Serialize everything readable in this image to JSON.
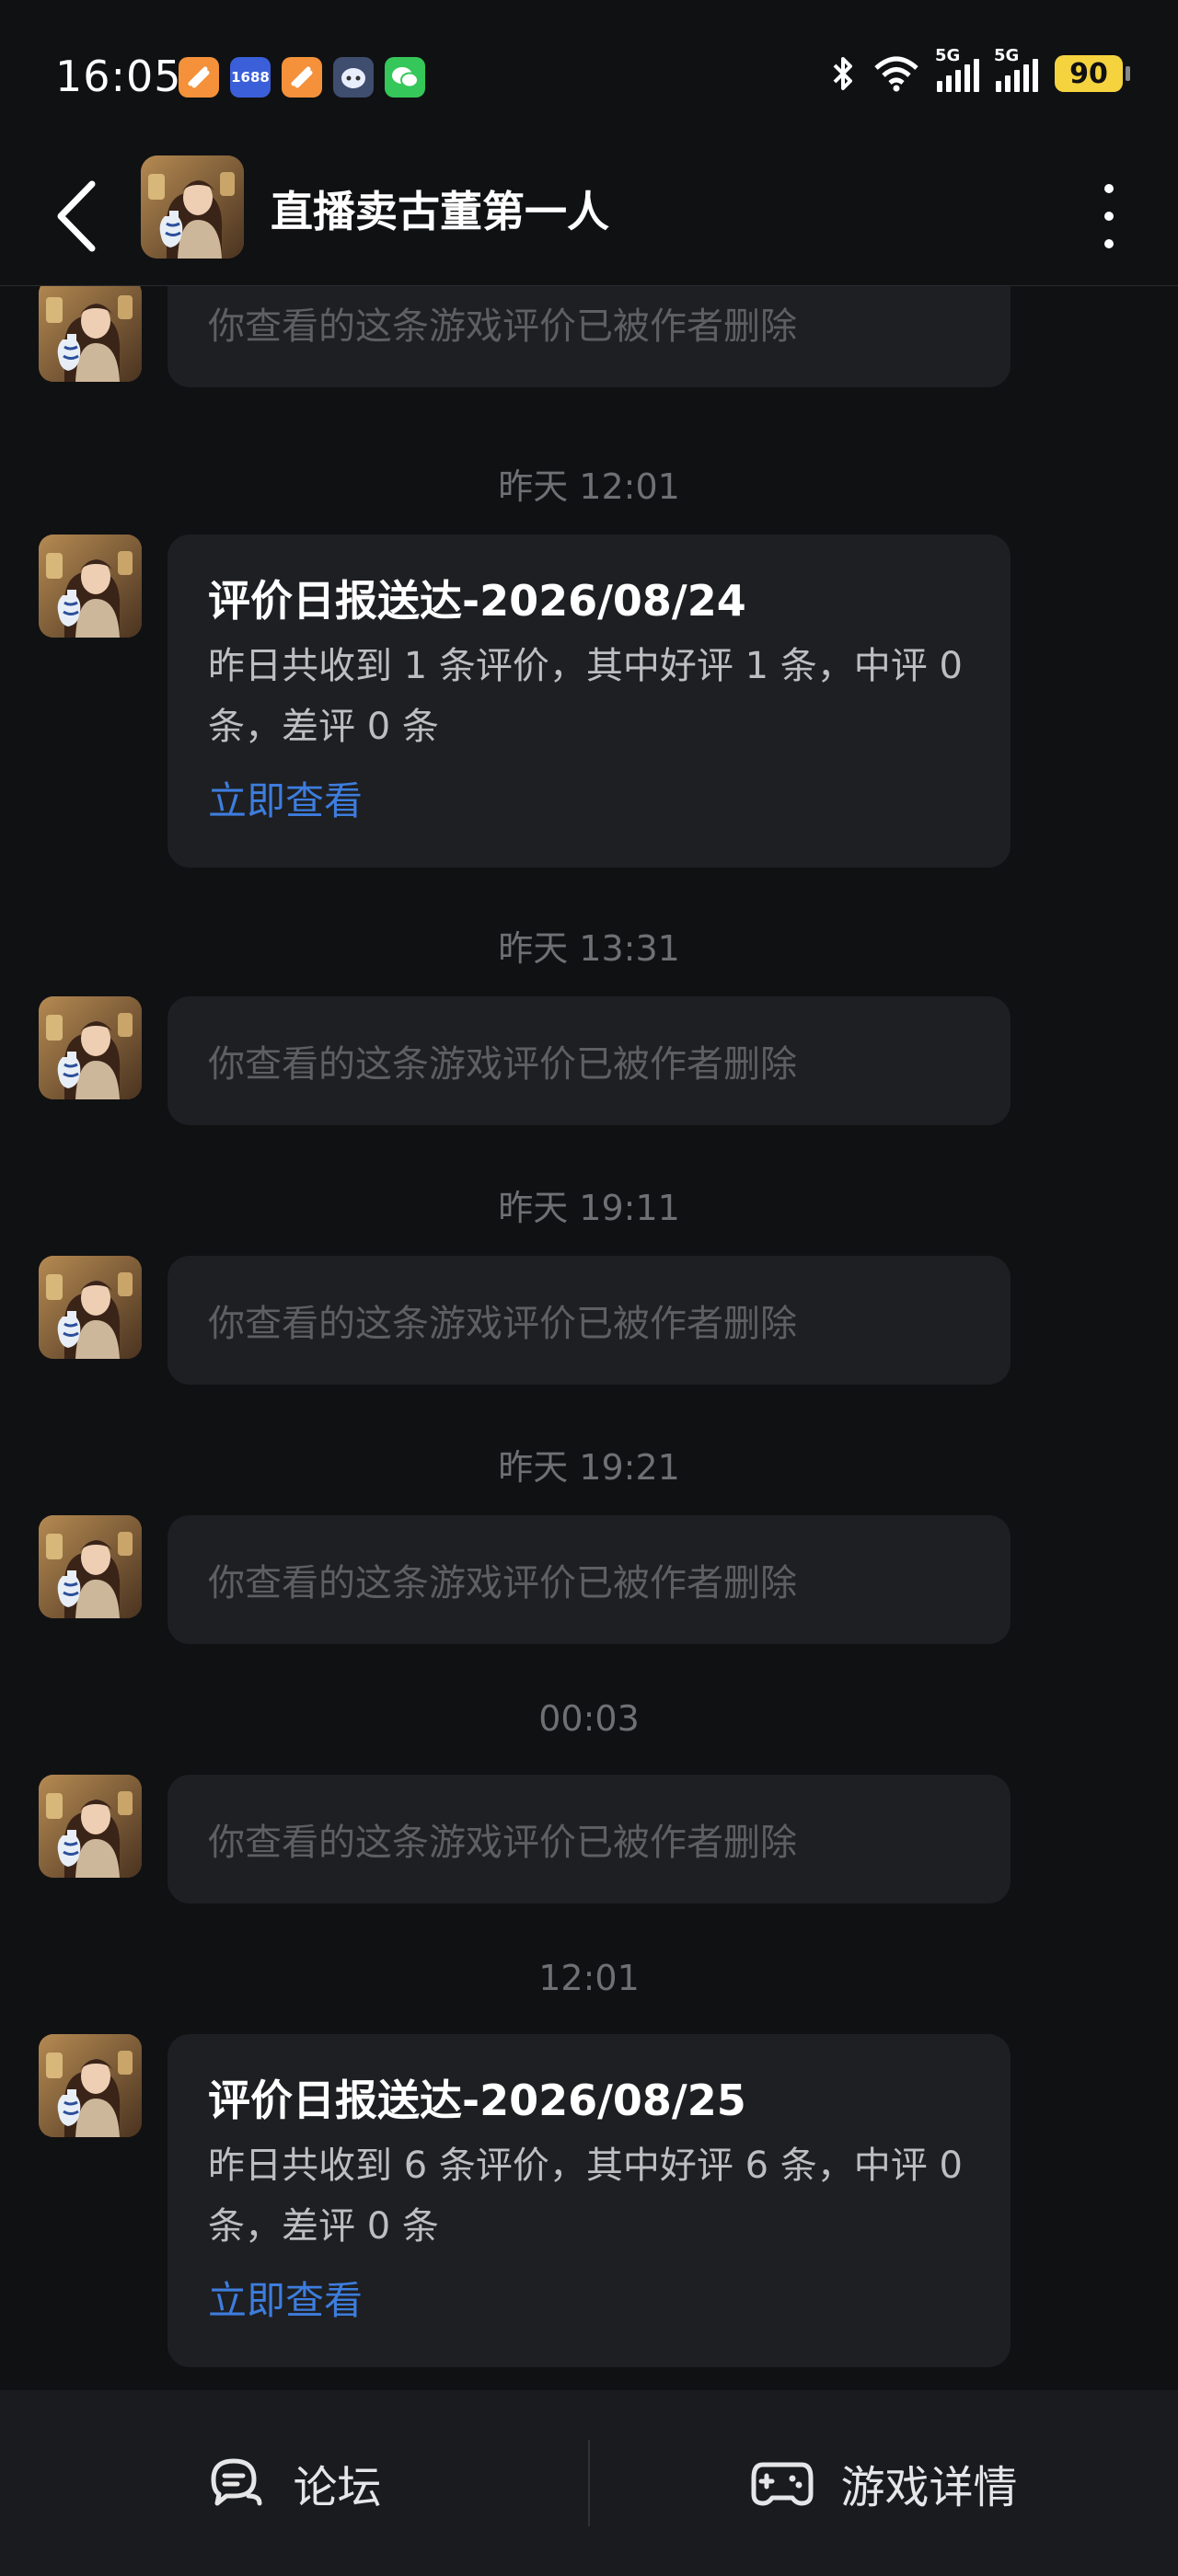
{
  "status_bar": {
    "time": "16:05",
    "apps": [
      "taobao-icon",
      "1688-icon",
      "taobao-icon",
      "ai-assistant-icon",
      "wechat-icon"
    ],
    "app_1688_label": "1688",
    "network": "5G",
    "battery": "90"
  },
  "header": {
    "title": "直播卖古董第一人"
  },
  "messages": [
    {
      "type": "deleted",
      "text": "你查看的这条游戏评价已被作者删除"
    },
    {
      "type": "timestamp",
      "text": "昨天 12:01"
    },
    {
      "type": "report",
      "title": "评价日报送达-2026/08/24",
      "body": "昨日共收到 1 条评价，其中好评 1 条，中评 0 条，差评 0 条",
      "link": "立即查看"
    },
    {
      "type": "timestamp",
      "text": "昨天 13:31"
    },
    {
      "type": "deleted",
      "text": "你查看的这条游戏评价已被作者删除"
    },
    {
      "type": "timestamp",
      "text": "昨天 19:11"
    },
    {
      "type": "deleted",
      "text": "你查看的这条游戏评价已被作者删除"
    },
    {
      "type": "timestamp",
      "text": "昨天 19:21"
    },
    {
      "type": "deleted",
      "text": "你查看的这条游戏评价已被作者删除"
    },
    {
      "type": "timestamp",
      "text": "00:03"
    },
    {
      "type": "deleted",
      "text": "你查看的这条游戏评价已被作者删除"
    },
    {
      "type": "timestamp",
      "text": "12:01"
    },
    {
      "type": "report",
      "title": "评价日报送达-2026/08/25",
      "body": "昨日共收到 6 条评价，其中好评 6 条，中评 0 条，差评 0 条",
      "link": "立即查看"
    }
  ],
  "bottom_bar": {
    "forum_label": "论坛",
    "game_detail_label": "游戏详情"
  },
  "colors": {
    "background": "#101113",
    "bubble": "#1e1f23",
    "link": "#3d7dde",
    "battery": "#f5d33f"
  }
}
